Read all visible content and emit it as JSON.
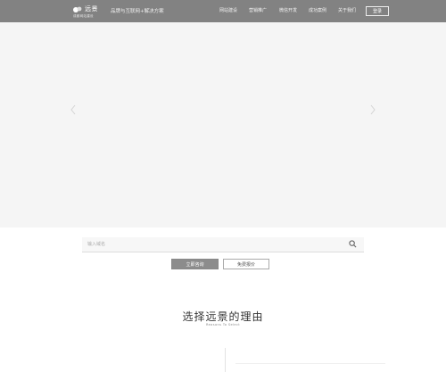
{
  "header": {
    "logo_title": "远景",
    "logo_sub": "成都网站建设",
    "tagline": "品牌与互联网+解决方案",
    "nav": [
      "网站建设",
      "营销推广",
      "微信开发",
      "成功案例",
      "关于我们"
    ],
    "login_label": "登录"
  },
  "search": {
    "placeholder": "输入域名"
  },
  "buttons": {
    "primary_label": "立即咨询",
    "secondary_label": "免费报价"
  },
  "section": {
    "title": "选择远景的理由",
    "subtitle": "Reasons To Select"
  },
  "icons": {
    "logo": "logo-icon",
    "prev": "chevron-left-icon",
    "next": "chevron-right-icon",
    "search": "search-icon"
  },
  "colors": {
    "topbar": "#828282",
    "hero": "#f5f5f5",
    "primary_button": "#8c8c8c"
  }
}
